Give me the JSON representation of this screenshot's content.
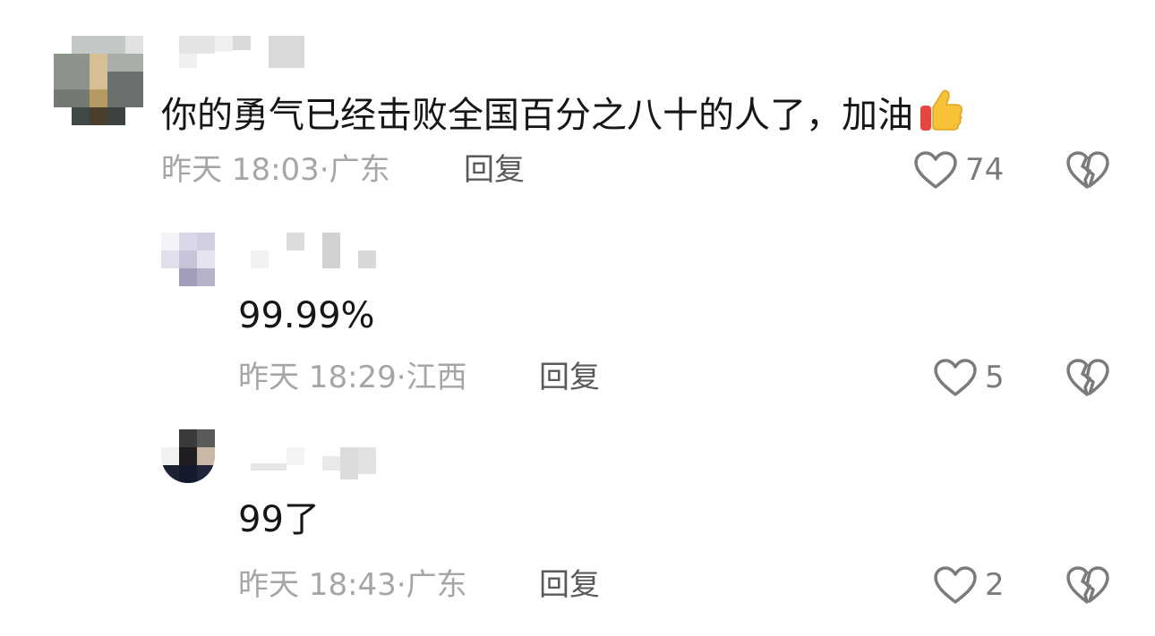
{
  "comments": [
    {
      "text": "你的勇气已经击败全国百分之八十的人了，加油",
      "emoji": "thumbs-up-icon",
      "time": "昨天 18:03",
      "sep": "·",
      "location": "广东",
      "reply_label": "回复",
      "likes": "74"
    },
    {
      "text": "99.99%",
      "time": "昨天 18:29",
      "sep": "·",
      "location": "江西",
      "reply_label": "回复",
      "likes": "5"
    },
    {
      "text": "99了",
      "time": "昨天 18:43",
      "sep": "·",
      "location": "广东",
      "reply_label": "回复",
      "likes": "2"
    }
  ],
  "icons": {
    "like": "heart-outline-icon",
    "dislike": "broken-heart-icon"
  },
  "colors": {
    "text": "#161616",
    "meta": "#a6a6a6",
    "reply": "#5a5a5a",
    "icon": "#7b7b7b"
  }
}
